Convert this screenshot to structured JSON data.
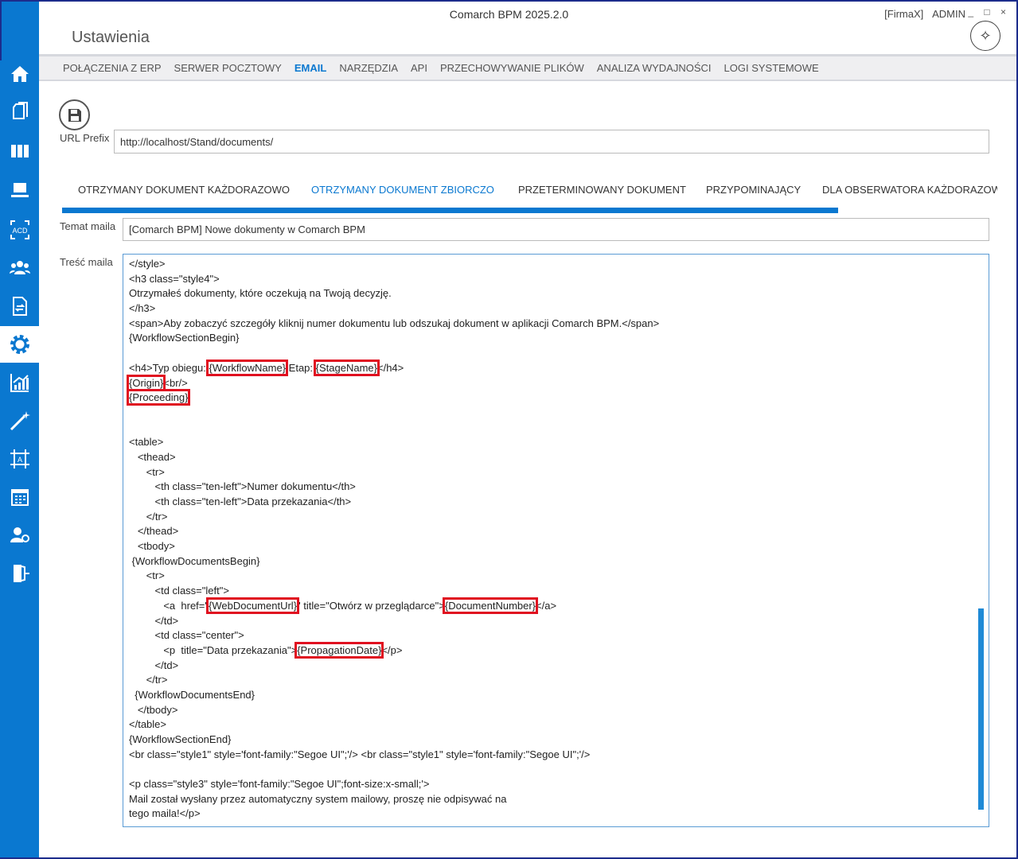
{
  "app": {
    "title": "Comarch BPM 2025.2.0",
    "company": "[FirmaX]",
    "user": "ADMIN",
    "window_controls": "_ □ ×",
    "page_title": "Ustawienia"
  },
  "menu": [
    {
      "label": "POŁĄCZENIA Z ERP"
    },
    {
      "label": "SERWER POCZTOWY"
    },
    {
      "label": "EMAIL",
      "active": true
    },
    {
      "label": "NARZĘDZIA"
    },
    {
      "label": "API"
    },
    {
      "label": "PRZECHOWYWANIE PLIKÓW"
    },
    {
      "label": "ANALIZA WYDAJNOŚCI"
    },
    {
      "label": "LOGI SYSTEMOWE"
    }
  ],
  "sidebar": [
    "home",
    "documents",
    "library",
    "workstation",
    "acd",
    "users",
    "document-cycle",
    "settings",
    "analytics",
    "wand",
    "designer",
    "calendar",
    "user-settings",
    "logout"
  ],
  "url_prefix": {
    "label": "URL Prefix",
    "value": "http://localhost/Stand/documents/"
  },
  "tabs": [
    "OTRZYMANY DOKUMENT KAŻDORAZOWO",
    "OTRZYMANY DOKUMENT ZBIORCZO",
    "PRZETERMINOWANY DOKUMENT",
    "PRZYPOMINAJĄCY",
    "DLA OBSERWATORA KAŻDORAZOWO"
  ],
  "active_tab": 1,
  "subject": {
    "label": "Temat maila",
    "value": "[Comarch BPM] Nowe dokumenty w Comarch BPM"
  },
  "body_label": "Treść maila",
  "body_lines": [
    [
      [
        "</style>"
      ]
    ],
    [
      [
        "<h3 class=\"style4\">"
      ]
    ],
    [
      [
        "Otrzymałeś dokumenty, które oczekują na Twoją decyzję."
      ]
    ],
    [
      [
        "</h3>"
      ]
    ],
    [
      [
        "<span>Aby zobaczyć szczegóły kliknij numer dokumentu lub odszukaj dokument w aplikacji Comarch BPM.</span>"
      ]
    ],
    [
      [
        "{WorkflowSectionBegin}"
      ]
    ],
    [
      [
        ""
      ]
    ],
    [
      [
        "<h4>Typ obiegu: "
      ],
      [
        "{WorkflowName}",
        1
      ],
      [
        " Etap: "
      ],
      [
        "{StageName}",
        1
      ],
      [
        "</h4>"
      ]
    ],
    [
      [
        "{Origin}",
        1
      ],
      [
        "<br/>"
      ]
    ],
    [
      [
        "{Proceeding}",
        1
      ]
    ],
    [
      [
        ""
      ]
    ],
    [
      [
        ""
      ]
    ],
    [
      [
        "<table>"
      ]
    ],
    [
      [
        "   <thead>"
      ]
    ],
    [
      [
        "      <tr>"
      ]
    ],
    [
      [
        "         <th class=\"ten-left\">Numer dokumentu</th>"
      ]
    ],
    [
      [
        "         <th class=\"ten-left\">Data przekazania</th>"
      ]
    ],
    [
      [
        "      </tr>"
      ]
    ],
    [
      [
        "   </thead>"
      ]
    ],
    [
      [
        "   <tbody>"
      ]
    ],
    [
      [
        " {WorkflowDocumentsBegin}"
      ]
    ],
    [
      [
        "      <tr>"
      ]
    ],
    [
      [
        "         <td class=\"left\">"
      ]
    ],
    [
      [
        "            <a  href=\""
      ],
      [
        "{WebDocumentUrl}",
        1
      ],
      [
        "\" title=\"Otwórz w przeglądarce\">"
      ],
      [
        "{DocumentNumber}",
        1
      ],
      [
        "</a>"
      ]
    ],
    [
      [
        "         </td>"
      ]
    ],
    [
      [
        "         <td class=\"center\">"
      ]
    ],
    [
      [
        "            <p  title=\"Data przekazania\">"
      ],
      [
        "{PropagationDate}",
        1
      ],
      [
        "</p>"
      ]
    ],
    [
      [
        "         </td>"
      ]
    ],
    [
      [
        "      </tr>"
      ]
    ],
    [
      [
        "  {WorkflowDocumentsEnd}"
      ]
    ],
    [
      [
        "   </tbody>"
      ]
    ],
    [
      [
        "</table>"
      ]
    ],
    [
      [
        "{WorkflowSectionEnd}"
      ]
    ],
    [
      [
        "<br class=\"style1\" style='font-family:\"Segoe UI\";'/> <br class=\"style1\" style='font-family:\"Segoe UI\";'/>"
      ]
    ],
    [
      [
        ""
      ]
    ],
    [
      [
        "<p class=\"style3\" style='font-family:\"Segoe UI\";font-size:x-small;'>"
      ]
    ],
    [
      [
        "Mail został wysłany przez automatyczny system mailowy, proszę nie odpisywać na"
      ]
    ],
    [
      [
        "tego maila!</p>"
      ]
    ]
  ]
}
